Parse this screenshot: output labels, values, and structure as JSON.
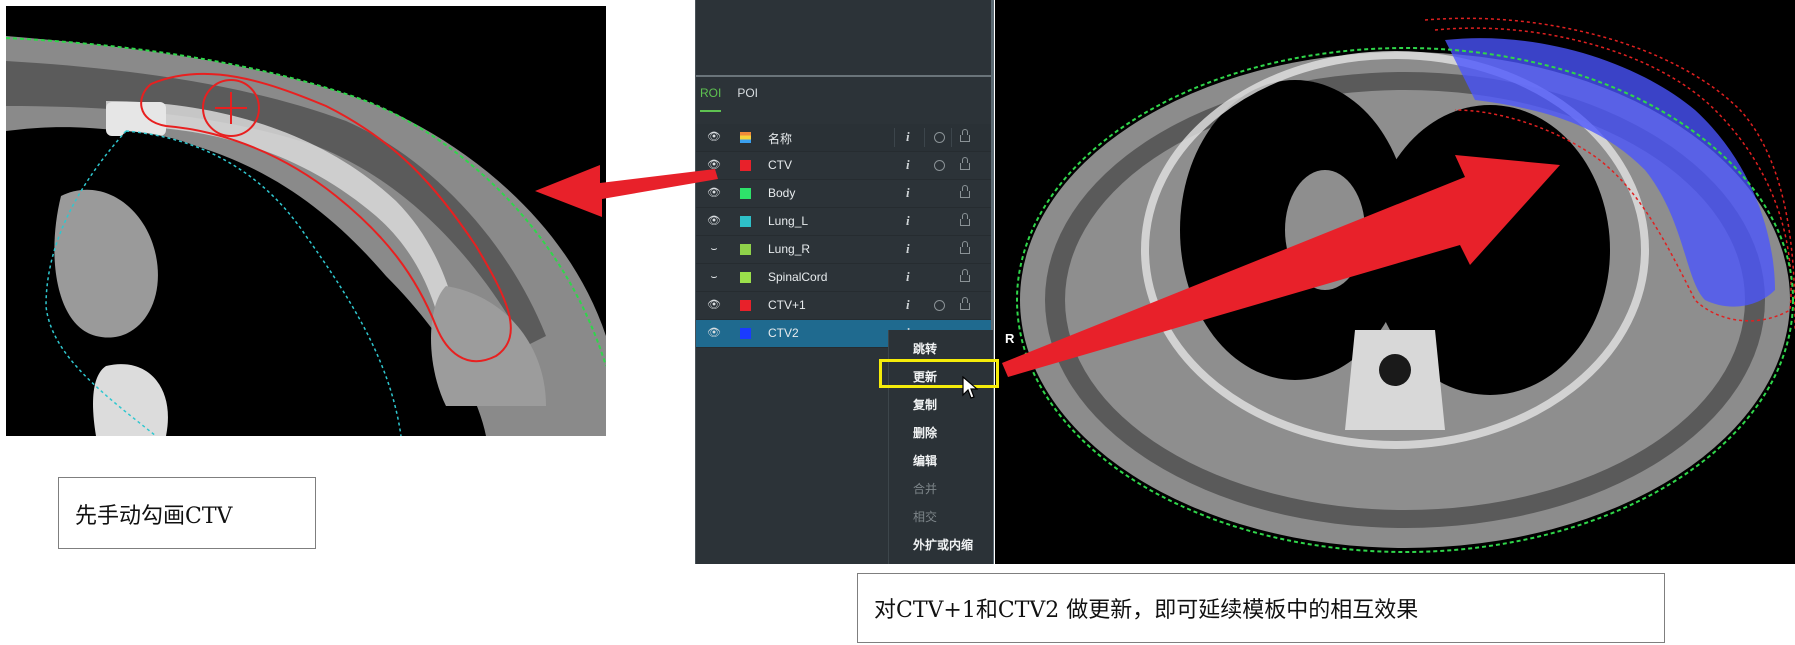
{
  "panel": {
    "tabs": [
      {
        "label": "ROI",
        "active": true
      },
      {
        "label": "POI",
        "active": false
      }
    ],
    "header": {
      "name": "名称",
      "info": "i"
    },
    "rows": [
      {
        "name": "CTV",
        "color": "#e8212a",
        "visible": true,
        "info": "i",
        "selected": false
      },
      {
        "name": "Body",
        "color": "#2ee36a",
        "visible": true,
        "info": "i",
        "selected": false
      },
      {
        "name": "Lung_L",
        "color": "#2ec0c8",
        "visible": true,
        "info": "i",
        "selected": false
      },
      {
        "name": "Lung_R",
        "color": "#8fd24a",
        "visible": false,
        "info": "i",
        "selected": false
      },
      {
        "name": "SpinalCord",
        "color": "#9be04b",
        "visible": false,
        "info": "i",
        "selected": false
      },
      {
        "name": "CTV+1",
        "color": "#e8212a",
        "visible": true,
        "info": "i",
        "selected": false
      },
      {
        "name": "CTV2",
        "color": "#1a3bff",
        "visible": true,
        "info": "i",
        "selected": true
      }
    ]
  },
  "context_menu": {
    "items": [
      {
        "label": "跳转",
        "enabled": true
      },
      {
        "label": "更新",
        "enabled": true,
        "highlighted": true
      },
      {
        "label": "复制",
        "enabled": true
      },
      {
        "label": "删除",
        "enabled": true
      },
      {
        "label": "编辑",
        "enabled": true
      },
      {
        "label": "合并",
        "enabled": false
      },
      {
        "label": "相交",
        "enabled": false
      },
      {
        "label": "外扩或内缩",
        "enabled": true
      }
    ]
  },
  "orientation_label": "R",
  "captions": {
    "left": "先手动勾画CTV",
    "right": "对CTV+1和CTV2 做更新，即可延续模板中的相互效果"
  },
  "colors": {
    "accent_green": "#5ec251",
    "selection_blue": "#1f6a8f",
    "highlight_yellow": "#f5ec0a",
    "arrow_red": "#e8212a",
    "panel_bg": "#2c3338"
  }
}
